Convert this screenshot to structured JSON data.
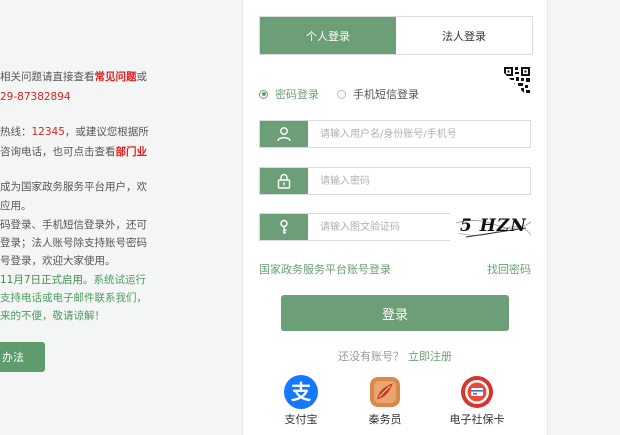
{
  "notice": {
    "l1a": "相关问题请直接查看",
    "l1b": "常见问题",
    "l1c": "或",
    "l2": "29-87382894",
    "l3a": "热线：",
    "l3b": "12345",
    "l3c": "，或建议您根据所",
    "l4a": "咨询电话，也可点击查看",
    "l4b": "部门业",
    "l5": "成为国家政务服务平台用户，欢",
    "l6": "应用。",
    "l7": "码登录、手机短信登录外，还可",
    "l8": "登录；法人账号除支持账号密码",
    "l9": "号登录，欢迎大家使用。",
    "l10a": "11月7日正式启用。",
    "l10b": "系统试运行",
    "l11": "支持电话或电子邮件联系我们，",
    "l12": "来的不便，敬请谅解！",
    "method_button": "办法"
  },
  "login": {
    "tabs": [
      "个人登录",
      "法人登录"
    ],
    "radios": [
      "密码登录",
      "手机短信登录"
    ],
    "username_placeholder": "请输入用户名/身份账号/手机号",
    "password_placeholder": "请输入密码",
    "captcha_placeholder": "请输入图文验证码",
    "captcha_text": "5 HZN",
    "platform_link": "国家政务服务平台账号登录",
    "forgot_link": "找回密码",
    "login_button": "登录",
    "no_account": "还没有账号？",
    "register_link": "立即注册",
    "alt_logins": [
      "支付宝",
      "秦务员",
      "电子社保卡"
    ]
  },
  "icons": {
    "user": "user-icon",
    "lock": "lock-icon",
    "key": "key-icon",
    "qr": "qr-code-icon",
    "alipay": "alipay-icon",
    "qinwuyuan": "qinwuyuan-icon",
    "social_card": "social-security-card-icon"
  },
  "colors": {
    "accent": "#6c9f77",
    "link_red": "#e02020",
    "alipay_blue": "#1677ff",
    "card_red": "#d9342b"
  }
}
